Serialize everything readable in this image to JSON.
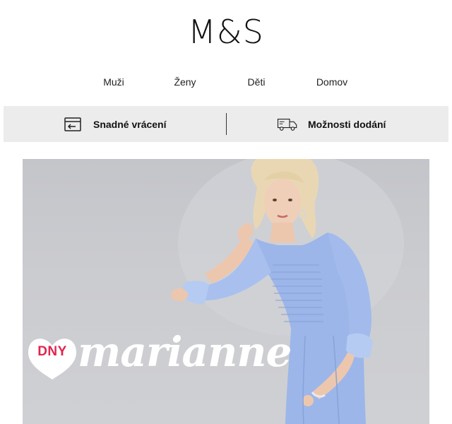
{
  "header": {
    "logo": "M&S"
  },
  "nav": {
    "items": [
      {
        "label": "Muži"
      },
      {
        "label": "Ženy"
      },
      {
        "label": "Děti"
      },
      {
        "label": "Domov"
      }
    ]
  },
  "benefits": {
    "items": [
      {
        "label": "Snadné vrácení",
        "icon": "return-box-icon"
      },
      {
        "label": "Možnosti dodání",
        "icon": "delivery-truck-icon"
      }
    ]
  },
  "hero": {
    "badge_text": "DNY",
    "campaign_text": "marianne",
    "colors": {
      "badge": "#e0254f",
      "dress": "#9cb6ea",
      "background": "#c8c9ce"
    }
  }
}
